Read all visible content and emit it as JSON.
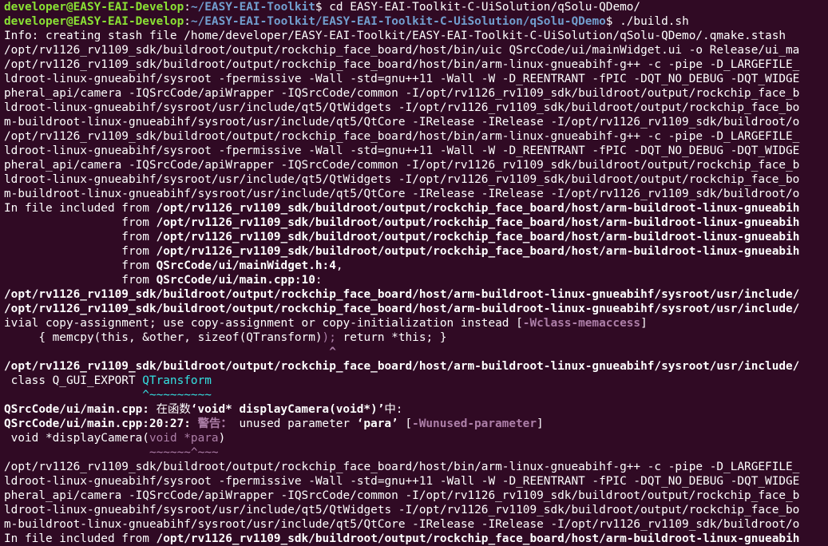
{
  "terminal": {
    "prompts": [
      {
        "user": "developer@EASY-EAI-Develop",
        "path": "~/EASY-EAI-Toolkit",
        "symbol": "$ ",
        "command": "cd EASY-EAI-Toolkit-C-UiSolution/qSolu-QDemo/"
      },
      {
        "user": "developer@EASY-EAI-Develop",
        "path": "~/EASY-EAI-Toolkit/EASY-EAI-Toolkit-C-UiSolution/qSolu-QDemo",
        "symbol": "$ ",
        "command": "./build.sh"
      }
    ],
    "lines": {
      "l03": "Info: creating stash file /home/developer/EASY-EAI-Toolkit/EASY-EAI-Toolkit-C-UiSolution/qSolu-QDemo/.qmake.stash",
      "l04": "/opt/rv1126_rv1109_sdk/buildroot/output/rockchip_face_board/host/bin/uic QSrcCode/ui/mainWidget.ui -o Release/ui_ma",
      "l05": "/opt/rv1126_rv1109_sdk/buildroot/output/rockchip_face_board/host/bin/arm-linux-gnueabihf-g++ -c -pipe -D_LARGEFILE_",
      "l06": "ldroot-linux-gnueabihf/sysroot -fpermissive -Wall -std=gnu++11 -Wall -W -D_REENTRANT -fPIC -DQT_NO_DEBUG -DQT_WIDGE",
      "l07": "pheral_api/camera -IQSrcCode/apiWrapper -IQSrcCode/common -I/opt/rv1126_rv1109_sdk/buildroot/output/rockchip_face_b",
      "l08": "ldroot-linux-gnueabihf/sysroot/usr/include/qt5/QtWidgets -I/opt/rv1126_rv1109_sdk/buildroot/output/rockchip_face_bo",
      "l09": "m-buildroot-linux-gnueabihf/sysroot/usr/include/qt5/QtCore -IRelease -IRelease -I/opt/rv1126_rv1109_sdk/buildroot/o",
      "l10": "/opt/rv1126_rv1109_sdk/buildroot/output/rockchip_face_board/host/bin/arm-linux-gnueabihf-g++ -c -pipe -D_LARGEFILE_",
      "l11": "ldroot-linux-gnueabihf/sysroot -fpermissive -Wall -std=gnu++11 -Wall -W -D_REENTRANT -fPIC -DQT_NO_DEBUG -DQT_WIDGE",
      "l12": "pheral_api/camera -IQSrcCode/apiWrapper -IQSrcCode/common -I/opt/rv1126_rv1109_sdk/buildroot/output/rockchip_face_b",
      "l13": "ldroot-linux-gnueabihf/sysroot/usr/include/qt5/QtWidgets -I/opt/rv1126_rv1109_sdk/buildroot/output/rockchip_face_bo",
      "l14": "m-buildroot-linux-gnueabihf/sysroot/usr/include/qt5/QtCore -IRelease -IRelease -I/opt/rv1126_rv1109_sdk/buildroot/o",
      "l15_prefix": "In file included from ",
      "l15_path": "/opt/rv1126_rv1109_sdk/buildroot/output/rockchip_face_board/host/arm-buildroot-linux-gnueabih",
      "l16_prefix": "                 from ",
      "l16_path": "/opt/rv1126_rv1109_sdk/buildroot/output/rockchip_face_board/host/arm-buildroot-linux-gnueabih",
      "l17_prefix": "                 from ",
      "l17_path": "/opt/rv1126_rv1109_sdk/buildroot/output/rockchip_face_board/host/arm-buildroot-linux-gnueabih",
      "l18_prefix": "                 from ",
      "l18_path": "/opt/rv1126_rv1109_sdk/buildroot/output/rockchip_face_board/host/arm-buildroot-linux-gnueabih",
      "l19_prefix": "                 from ",
      "l19_path": "QSrcCode/ui/mainWidget.h:4",
      "l19_suffix": ",",
      "l20_prefix": "                 from ",
      "l20_path": "QSrcCode/ui/main.cpp:10",
      "l20_suffix": ":",
      "l21": "/opt/rv1126_rv1109_sdk/buildroot/output/rockchip_face_board/host/arm-buildroot-linux-gnueabihf/sysroot/usr/include/",
      "l22": "/opt/rv1126_rv1109_sdk/buildroot/output/rockchip_face_board/host/arm-buildroot-linux-gnueabihf/sysroot/usr/include/",
      "l23_text": "ivial copy-assignment; use copy-assignment or copy-initialization instead [",
      "l23_flag": "-Wclass-memaccess",
      "l23_end": "]",
      "l24_a": "     { memcpy(this, &other, sizeof(QTransform)",
      "l24_b": ");",
      "l24_c": " return *this; }",
      "l25": "                                               ^",
      "l26": "/opt/rv1126_rv1109_sdk/buildroot/output/rockchip_face_board/host/arm-buildroot-linux-gnueabihf/sysroot/usr/include/",
      "l27_a": " class Q_GUI_EXPORT ",
      "l27_b": "QTransform",
      "l28": "                    ^~~~~~~~~~",
      "l29_a": "QSrcCode/ui/main.cpp:",
      "l29_b": " 在函数",
      "l29_c": "‘void* displayCamera(void*)’",
      "l29_d": "中:",
      "l30_a": "QSrcCode/ui/main.cpp:20:27:",
      "l30_b": " 警告：",
      "l30_c": " unused parameter ",
      "l30_d": "‘para’",
      "l30_e": " [",
      "l30_f": "-Wunused-parameter",
      "l30_g": "]",
      "l31_a": " void *displayCamera(",
      "l31_b": "void *para",
      "l31_c": ")",
      "l32": "                     ~~~~~~^~~~",
      "l33": "/opt/rv1126_rv1109_sdk/buildroot/output/rockchip_face_board/host/bin/arm-linux-gnueabihf-g++ -c -pipe -D_LARGEFILE_",
      "l34": "ldroot-linux-gnueabihf/sysroot -fpermissive -Wall -std=gnu++11 -Wall -W -D_REENTRANT -fPIC -DQT_NO_DEBUG -DQT_WIDGE",
      "l35": "pheral_api/camera -IQSrcCode/apiWrapper -IQSrcCode/common -I/opt/rv1126_rv1109_sdk/buildroot/output/rockchip_face_b",
      "l36": "ldroot-linux-gnueabihf/sysroot/usr/include/qt5/QtWidgets -I/opt/rv1126_rv1109_sdk/buildroot/output/rockchip_face_bo",
      "l37": "m-buildroot-linux-gnueabihf/sysroot/usr/include/qt5/QtCore -IRelease -IRelease -I/opt/rv1126_rv1109_sdk/buildroot/o",
      "l38_prefix": "In file included from ",
      "l38_path": "/opt/rv1126_rv1109_sdk/buildroot/output/rockchip_face_board/host/arm-buildroot-linux-gnueabih"
    },
    "colors": {
      "background": "#300a24",
      "foreground": "#ffffff",
      "prompt_user": "#8ae234",
      "prompt_path": "#729fcf",
      "warning": "#ad7fa8",
      "caret": "#8ae234",
      "type_highlight": "#34e2e2"
    }
  }
}
